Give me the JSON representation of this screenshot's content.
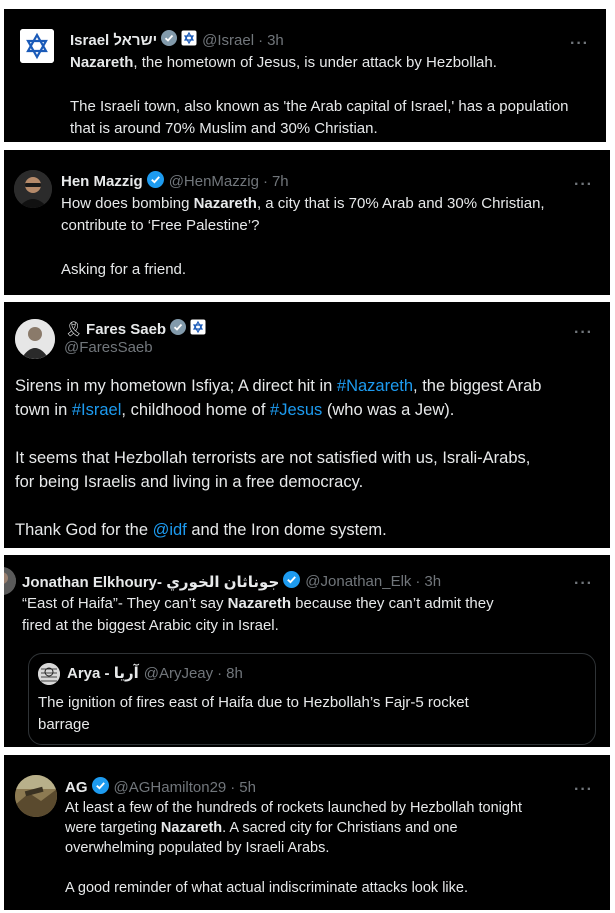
{
  "tweets": [
    {
      "name": "Israel ישראל",
      "handle": "@Israel",
      "sep": "·",
      "time": "3h",
      "more": "···",
      "lines": [
        {
          "bold": "Nazareth",
          "rest": ", the hometown of Jesus, is under attack by Hezbollah."
        },
        {
          "text": "The Israeli town, also known as 'the Arab capital of Israel,' has a population"
        },
        {
          "text": "that is around 70% Muslim and 30% Christian."
        }
      ]
    },
    {
      "name": "Hen Mazzig",
      "handle": "@HenMazzig",
      "sep": "·",
      "time": "7h",
      "more": "···",
      "lines": [
        {
          "pre": "How does bombing ",
          "bold": "Nazareth",
          "rest": ", a city that is 70% Arab and 30% Christian,"
        },
        {
          "text": "contribute to ‘Free Palestine’?"
        },
        {
          "text": "Asking for a friend."
        }
      ]
    },
    {
      "ribbon": "🎗",
      "name": "Fares Saeb",
      "handle": "@FaresSaeb",
      "more": "···",
      "lines": [
        {
          "pre": "Sirens in my hometown Isfiya; A direct hit in ",
          "link": "#Nazareth",
          "rest": ", the biggest Arab"
        },
        {
          "pre": "town in ",
          "link": "#Israel",
          "mid": ", childhood home of ",
          "link2": "#Jesus",
          "rest": " (who was a Jew)."
        },
        {
          "text": "It seems that Hezbollah terrorists are not satisfied with us, Israli-Arabs,"
        },
        {
          "text": "for being Israelis and living in a free democracy."
        },
        {
          "pre": "Thank God for the ",
          "link": "@idf",
          "rest": " and the Iron dome system."
        }
      ]
    },
    {
      "name": "Jonathan Elkhoury- جوناثان الخوري",
      "handle": "@Jonathan_Elk",
      "sep": "·",
      "time": "3h",
      "more": "···",
      "lines": [
        {
          "pre": "“East of Haifa”- They can’t say ",
          "bold": "Nazareth",
          "rest": " because they can’t admit they"
        },
        {
          "text": "fired at the biggest Arabic city in Israel."
        }
      ],
      "quote": {
        "name": "Arya - آریا",
        "handle": "@AryJeay",
        "sep": "·",
        "time": "8h",
        "lines": [
          "The ignition of fires east of Haifa due to Hezbollah’s Fajr-5 rocket",
          "barrage"
        ]
      }
    },
    {
      "name": "AG",
      "handle": "@AGHamilton29",
      "sep": "·",
      "time": "5h",
      "more": "···",
      "lines": [
        {
          "text": "At least a few of the hundreds of rockets launched by Hezbollah tonight"
        },
        {
          "pre": "were targeting ",
          "bold": "Nazareth",
          "rest": ". A sacred city for Christians and one"
        },
        {
          "text": "overwhelming populated by Israeli Arabs."
        },
        {
          "text": "A good reminder of what actual indiscriminate attacks look like."
        }
      ]
    }
  ],
  "colors": {
    "background": "#000000",
    "text": "#e7e9ea",
    "muted": "#71767b",
    "link": "#1d9bf0",
    "verified": "#1d9bf0"
  }
}
